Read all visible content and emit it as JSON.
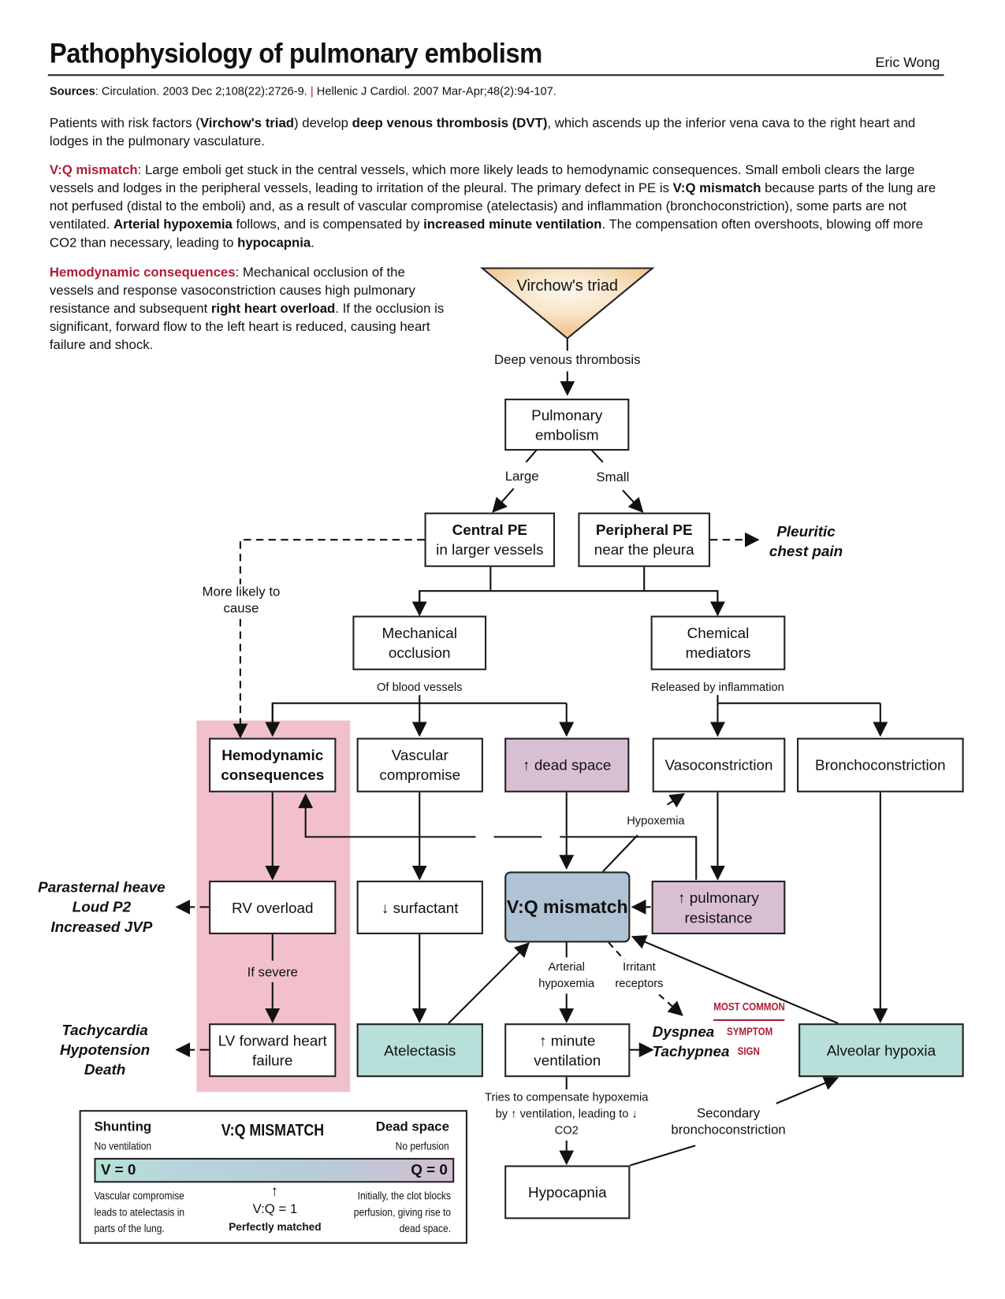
{
  "header": {
    "title": "Pathophysiology of pulmonary embolism",
    "author": "Eric Wong",
    "sources_label": "Sources",
    "source_1": ": Circulation. 2003 Dec 2;108(22):2726-9.",
    "separator": "|",
    "source_2": "Hellenic J Cardiol. 2007 Mar-Apr;48(2):94-107."
  },
  "intro": {
    "p1_a": "Patients with risk factors (",
    "p1_b": "Virchow's triad",
    "p1_c": ") develop ",
    "p1_d": "deep venous thrombosis (DVT)",
    "p1_e": ", which ascends up the inferior vena cava to the right heart and lodges in the pulmonary vasculature.",
    "p2_label": "V:Q mismatch",
    "p2_a": ": Large emboli get stuck in the central vessels, which more likely leads to hemodynamic consequences. Small emboli clears the large vessels and lodges in the peripheral vessels, leading to irritation of the pleural. The primary defect in PE is ",
    "p2_b": "V:Q mismatch",
    "p2_c": " because parts of the lung are not perfused (distal to the emboli) and, as a result of vascular compromise (atelectasis) and inflammation (bronchoconstriction), some parts are not ventilated. ",
    "p2_d": "Arterial hypoxemia",
    "p2_e": " follows, and is compensated by ",
    "p2_f": "increased minute ventilation",
    "p2_g": ". The compensation often overshoots, blowing off more CO2 than necessary, leading to ",
    "p2_h": "hypocapnia",
    "p2_i": ".",
    "p3_label": "Hemodynamic consequences",
    "p3_a": ": Mechanical occlusion of the vessels and response vasoconstriction causes high pulmonary resistance and subsequent ",
    "p3_b": "right heart overload",
    "p3_c": ". If the occlusion is significant, forward flow to the left heart is reduced, causing heart failure and shock."
  },
  "nodes": {
    "virchow": "Virchow's triad",
    "dvt": "Deep venous thrombosis",
    "pe": "Pulmonary embolism",
    "large": "Large",
    "small": "Small",
    "central_title": "Central PE",
    "central_sub": "in larger vessels",
    "peripheral_title": "Peripheral PE",
    "peripheral_sub": "near the pleura",
    "pleuritic_1": "Pleuritic",
    "pleuritic_2": "chest pain",
    "more_likely": "More likely to cause",
    "mechanical": "Mechanical occlusion",
    "chemical": "Chemical mediators",
    "of_blood_vessels": "Of blood vessels",
    "released": "Released by inflammation",
    "hemodynamic": "Hemodynamic consequences",
    "vascular": "Vascular compromise",
    "dead_space": "↑ dead space",
    "vasoconstriction": "Vasoconstriction",
    "bronchoconstriction": "Bronchoconstriction",
    "hypoxemia": "Hypoxemia",
    "rv_overload": "RV overload",
    "surfactant": "↓ surfactant",
    "vq_mismatch": "V:Q mismatch",
    "pulm_resistance": "↑ pulmonary resistance",
    "rv_signs": [
      "Parasternal heave",
      "Loud P2",
      "Increased JVP"
    ],
    "if_severe": "If severe",
    "lv_failure": "LV forward heart failure",
    "lv_signs": [
      "Tachycardia",
      "Hypotension",
      "Death"
    ],
    "atelectasis": "Atelectasis",
    "arterial_hypoxemia": "Arterial hypoxemia",
    "irritant_receptors": "Irritant receptors",
    "minute_vent": "↑ minute ventilation",
    "most_common": "MOST COMMON",
    "dyspnea": "Dyspnea",
    "symptom": "SYMPTOM",
    "tachypnea": "Tachypnea",
    "sign": "SIGN",
    "alveolar": "Alveolar hypoxia",
    "tries": "Tries to compensate hypoxemia by ↑ ventilation, leading to ↓ CO2",
    "secondary": "Secondary bronchoconstriction",
    "hypocapnia": "Hypocapnia"
  },
  "legend": {
    "shunting": "Shunting",
    "no_ventilation": "No ventilation",
    "title": "V:Q MISMATCH",
    "dead_space": "Dead space",
    "no_perfusion": "No perfusion",
    "v_zero": "V = 0",
    "q_zero": "Q = 0",
    "left_note": "Vascular compromise leads to atelectasis in parts of the lung.",
    "center_value": "V:Q = 1",
    "center_label": "Perfectly matched",
    "right_note": "Initially, the clot blocks perfusion, giving rise to dead space."
  },
  "colors": {
    "accent_red": "#b01c36",
    "pink_band": "#f2c0cd",
    "purple": "#d9bfd4",
    "teal": "#b8e0da",
    "blue": "#afc3d4",
    "triangle": "#f5d3a6"
  }
}
